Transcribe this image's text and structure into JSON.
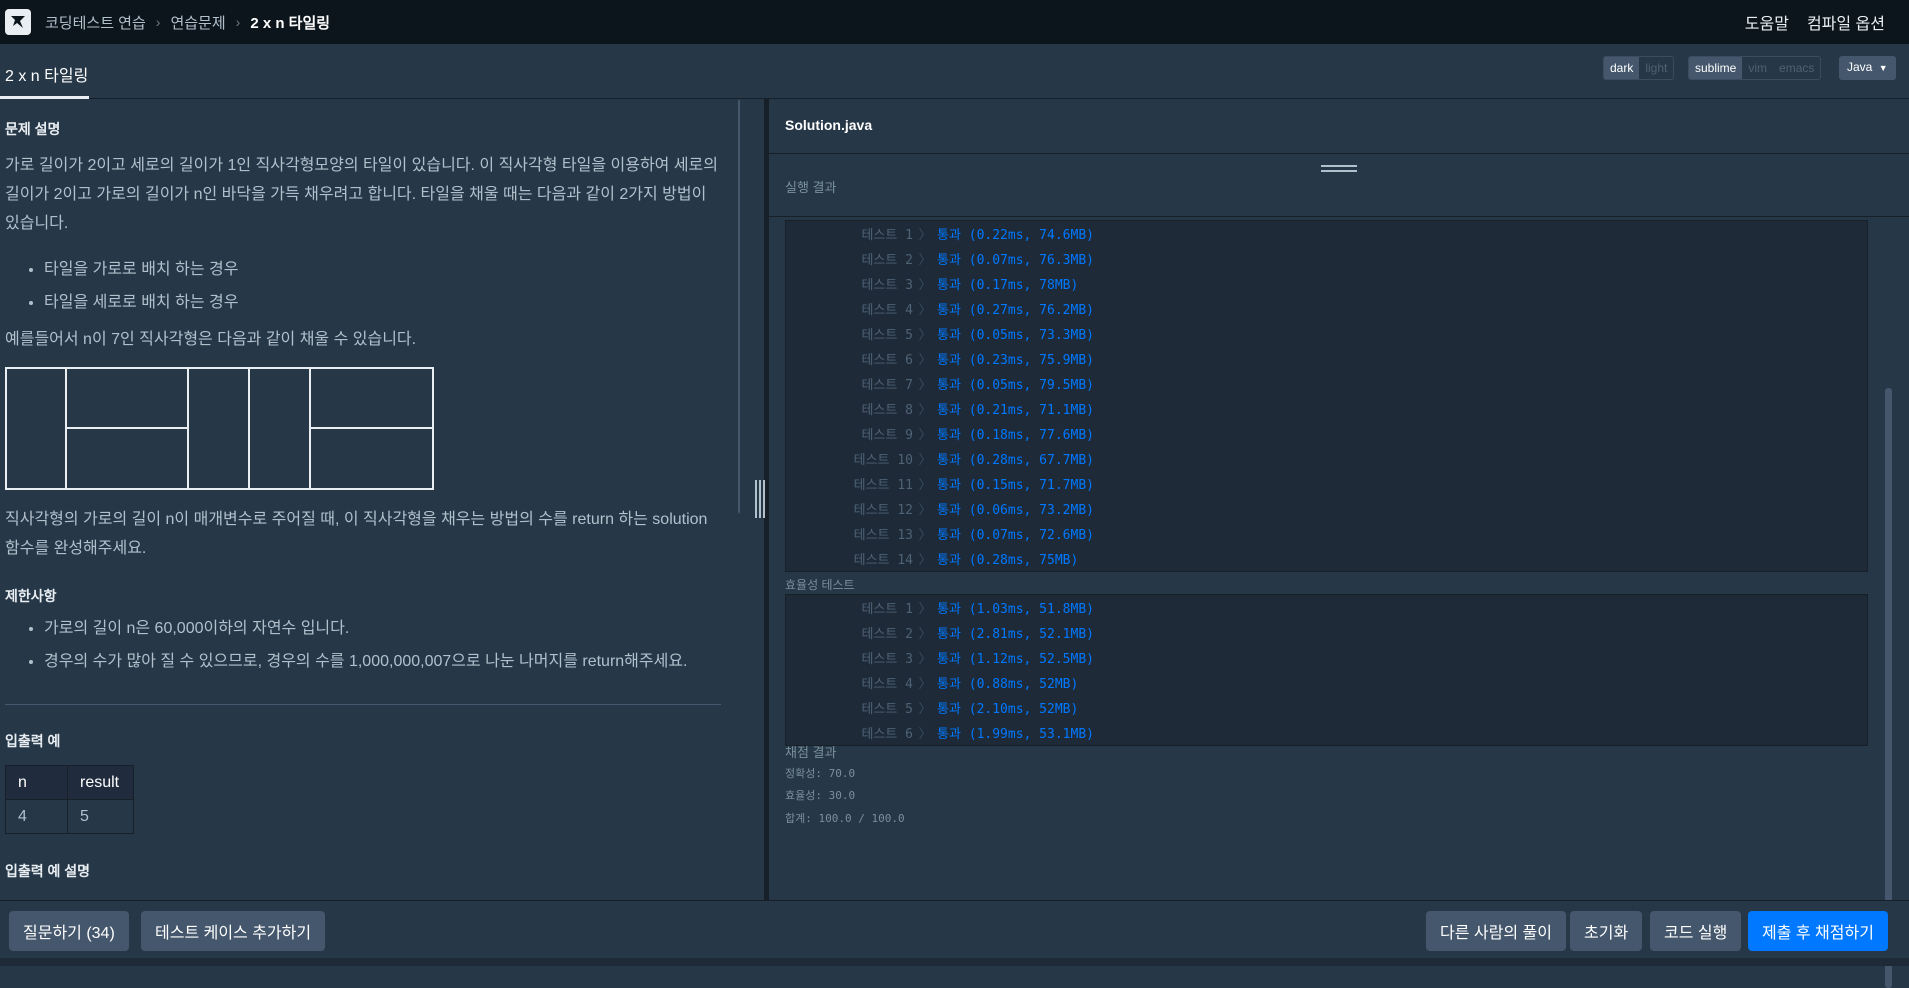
{
  "topbar": {
    "breadcrumb": [
      "코딩테스트 연습",
      "연습문제",
      "2 x n 타일링"
    ],
    "help": "도움말",
    "compile_options": "컴파일 옵션"
  },
  "tabbar": {
    "title": "2 x n 타일링",
    "theme_options": [
      "dark",
      "light"
    ],
    "keymap_options": [
      "sublime",
      "vim",
      "emacs"
    ],
    "language": "Java"
  },
  "problem": {
    "heading_desc": "문제 설명",
    "desc_1": "가로 길이가 2이고 세로의 길이가 1인 직사각형모양의 타일이 있습니다. 이 직사각형 타일을 이용하여 세로의 길이가 2이고 가로의 길이가 n인 바닥을 가득 채우려고 합니다. 타일을 채울 때는 다음과 같이 2가지 방법이 있습니다.",
    "bullets": [
      "타일을 가로로 배치 하는 경우",
      "타일을 세로로 배치 하는 경우"
    ],
    "example_text": "예를들어서 n이 7인 직사각형은 다음과 같이 채울 수 있습니다.",
    "desc_2": "직사각형의 가로의 길이 n이 매개변수로 주어질 때, 이 직사각형을 채우는 방법의 수를 return 하는 solution 함수를 완성해주세요.",
    "heading_constraints": "제한사항",
    "constraints": [
      "가로의 길이 n은 60,000이하의 자연수 입니다.",
      "경우의 수가 많아 질 수 있으므로, 경우의 수를 1,000,000,007으로 나눈 나머지를 return해주세요."
    ],
    "heading_io": "입출력 예",
    "io_headers": [
      "n",
      "result"
    ],
    "io_rows": [
      [
        "4",
        "5"
      ]
    ],
    "heading_io_desc": "입출력 예 설명"
  },
  "editor": {
    "filename": "Solution.java",
    "result_label": "실행 결과"
  },
  "results": {
    "accuracy_tests": [
      {
        "name": "테스트 1",
        "result": "통과 (0.22ms, 74.6MB)"
      },
      {
        "name": "테스트 2",
        "result": "통과 (0.07ms, 76.3MB)"
      },
      {
        "name": "테스트 3",
        "result": "통과 (0.17ms, 78MB)"
      },
      {
        "name": "테스트 4",
        "result": "통과 (0.27ms, 76.2MB)"
      },
      {
        "name": "테스트 5",
        "result": "통과 (0.05ms, 73.3MB)"
      },
      {
        "name": "테스트 6",
        "result": "통과 (0.23ms, 75.9MB)"
      },
      {
        "name": "테스트 7",
        "result": "통과 (0.05ms, 79.5MB)"
      },
      {
        "name": "테스트 8",
        "result": "통과 (0.21ms, 71.1MB)"
      },
      {
        "name": "테스트 9",
        "result": "통과 (0.18ms, 77.6MB)"
      },
      {
        "name": "테스트 10",
        "result": "통과 (0.28ms, 67.7MB)"
      },
      {
        "name": "테스트 11",
        "result": "통과 (0.15ms, 71.7MB)"
      },
      {
        "name": "테스트 12",
        "result": "통과 (0.06ms, 73.2MB)"
      },
      {
        "name": "테스트 13",
        "result": "통과 (0.07ms, 72.6MB)"
      },
      {
        "name": "테스트 14",
        "result": "통과 (0.28ms, 75MB)"
      }
    ],
    "efficiency_label": "효율성  테스트",
    "efficiency_tests": [
      {
        "name": "테스트 1",
        "result": "통과 (1.03ms, 51.8MB)"
      },
      {
        "name": "테스트 2",
        "result": "통과 (2.81ms, 52.1MB)"
      },
      {
        "name": "테스트 3",
        "result": "통과 (1.12ms, 52.5MB)"
      },
      {
        "name": "테스트 4",
        "result": "통과 (0.88ms, 52MB)"
      },
      {
        "name": "테스트 5",
        "result": "통과 (2.10ms, 52MB)"
      },
      {
        "name": "테스트 6",
        "result": "통과 (1.99ms, 53.1MB)"
      }
    ],
    "grading_label": "채점 결과",
    "accuracy_score": "정확성: 70.0",
    "efficiency_score": "효율성: 30.0",
    "total_score": "합계: 100.0 / 100.0"
  },
  "bottombar": {
    "ask": "질문하기 (34)",
    "add_testcase": "테스트 케이스 추가하기",
    "others_solution": "다른 사람의 풀이",
    "reset": "초기화",
    "run": "코드 실행",
    "submit": "제출 후 채점하기"
  },
  "colors": {
    "background": "#263747",
    "topbar": "#0c151c",
    "accent": "#0078ff",
    "button": "#44576c"
  }
}
